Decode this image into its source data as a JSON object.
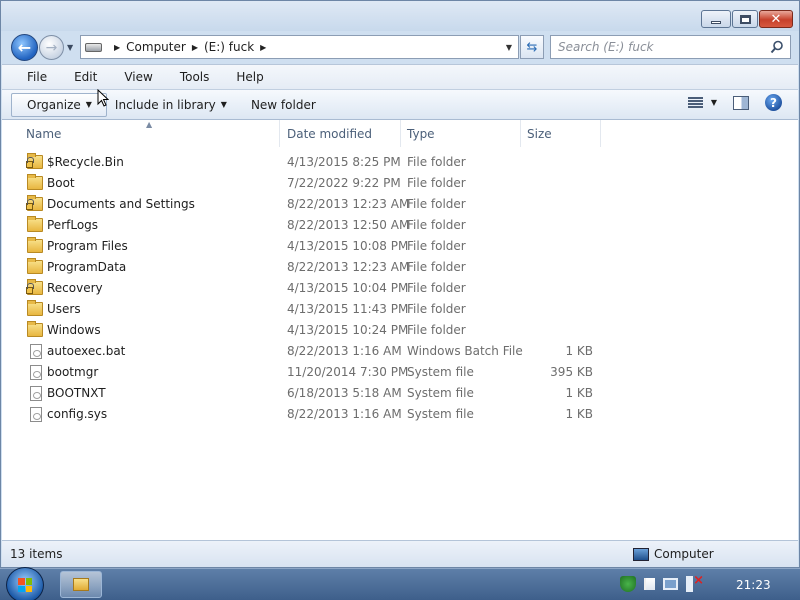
{
  "address": {
    "crumbs": [
      "Computer",
      "(E:) fuck"
    ]
  },
  "search": {
    "placeholder": "Search (E:) fuck"
  },
  "menubar": {
    "items": [
      "File",
      "Edit",
      "View",
      "Tools",
      "Help"
    ]
  },
  "toolbar": {
    "organize": "Organize",
    "include_in_library": "Include in library",
    "new_folder": "New folder"
  },
  "columns": {
    "name": "Name",
    "date_modified": "Date modified",
    "type": "Type",
    "size": "Size"
  },
  "files": [
    {
      "name": "$Recycle.Bin",
      "date": "4/13/2015 8:25 PM",
      "type": "File folder",
      "size": "",
      "icon": "locked-folder-icon"
    },
    {
      "name": "Boot",
      "date": "7/22/2022 9:22 PM",
      "type": "File folder",
      "size": "",
      "icon": "folder-icon"
    },
    {
      "name": "Documents and Settings",
      "date": "8/22/2013 12:23 AM",
      "type": "File folder",
      "size": "",
      "icon": "locked-folder-icon"
    },
    {
      "name": "PerfLogs",
      "date": "8/22/2013 12:50 AM",
      "type": "File folder",
      "size": "",
      "icon": "folder-icon"
    },
    {
      "name": "Program Files",
      "date": "4/13/2015 10:08 PM",
      "type": "File folder",
      "size": "",
      "icon": "folder-icon"
    },
    {
      "name": "ProgramData",
      "date": "8/22/2013 12:23 AM",
      "type": "File folder",
      "size": "",
      "icon": "folder-icon"
    },
    {
      "name": "Recovery",
      "date": "4/13/2015 10:04 PM",
      "type": "File folder",
      "size": "",
      "icon": "locked-folder-icon"
    },
    {
      "name": "Users",
      "date": "4/13/2015 11:43 PM",
      "type": "File folder",
      "size": "",
      "icon": "folder-icon"
    },
    {
      "name": "Windows",
      "date": "4/13/2015 10:24 PM",
      "type": "File folder",
      "size": "",
      "icon": "folder-icon"
    },
    {
      "name": "autoexec.bat",
      "date": "8/22/2013 1:16 AM",
      "type": "Windows Batch File",
      "size": "1 KB",
      "icon": "file-icon"
    },
    {
      "name": "bootmgr",
      "date": "11/20/2014 7:30 PM",
      "type": "System file",
      "size": "395 KB",
      "icon": "file-icon"
    },
    {
      "name": "BOOTNXT",
      "date": "6/18/2013 5:18 AM",
      "type": "System file",
      "size": "1 KB",
      "icon": "file-icon"
    },
    {
      "name": "config.sys",
      "date": "8/22/2013 1:16 AM",
      "type": "System file",
      "size": "1 KB",
      "icon": "file-icon"
    }
  ],
  "status": {
    "item_count": "13 items",
    "location": "Computer"
  },
  "taskbar": {
    "clock": "21:23"
  }
}
